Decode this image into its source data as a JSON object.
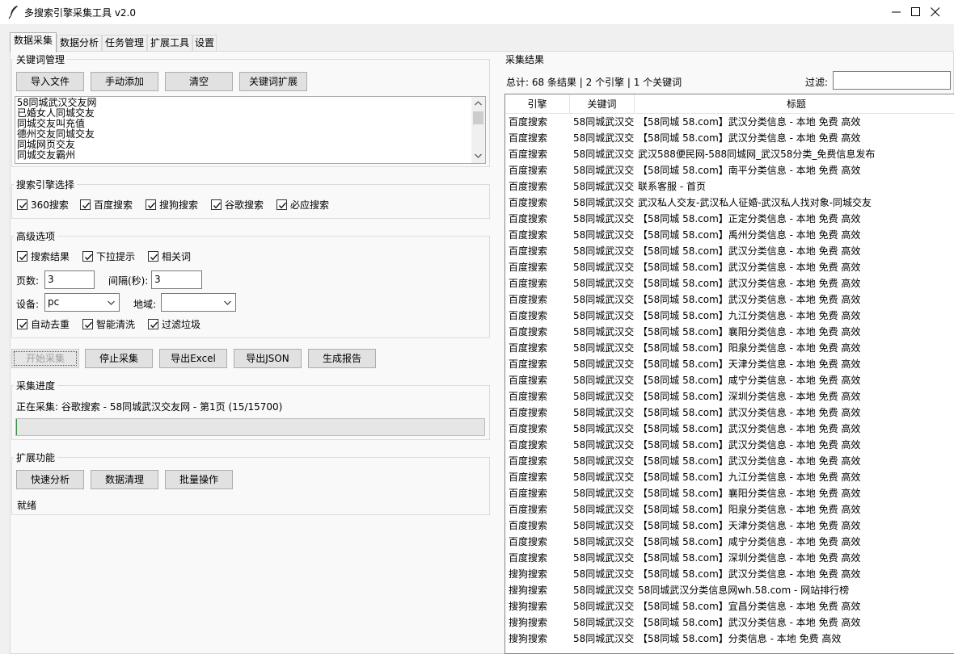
{
  "window": {
    "title": "多搜索引擎采集工具 v2.0"
  },
  "tabs": [
    "数据采集",
    "数据分析",
    "任务管理",
    "扩展工具",
    "设置"
  ],
  "keywords": {
    "group_label": "关键词管理",
    "buttons": [
      "导入文件",
      "手动添加",
      "清空",
      "关键词扩展"
    ],
    "lines": [
      "58同城武汉交友网",
      "已婚女人同城交友",
      "同城交友叫充值",
      "德州交友同城交友",
      "同城网页交友",
      "同城交友霸州"
    ]
  },
  "engines": {
    "group_label": "搜索引擎选择",
    "items": [
      {
        "label": "360搜索",
        "checked": true
      },
      {
        "label": "百度搜索",
        "checked": true
      },
      {
        "label": "搜狗搜索",
        "checked": true
      },
      {
        "label": "谷歌搜索",
        "checked": true
      },
      {
        "label": "必应搜索",
        "checked": true
      }
    ]
  },
  "advanced": {
    "group_label": "高级选项",
    "types": [
      {
        "label": "搜索结果",
        "checked": true
      },
      {
        "label": "下拉提示",
        "checked": true
      },
      {
        "label": "相关词",
        "checked": true
      }
    ],
    "pages_label": "页数:",
    "pages_value": "3",
    "interval_label": "间隔(秒):",
    "interval_value": "3",
    "device_label": "设备:",
    "device_value": "pc",
    "region_label": "地域:",
    "region_value": "",
    "options": [
      {
        "label": "自动去重",
        "checked": true
      },
      {
        "label": "智能清洗",
        "checked": true
      },
      {
        "label": "过滤垃圾",
        "checked": true
      }
    ]
  },
  "actions": [
    "开始采集",
    "停止采集",
    "导出Excel",
    "导出JSON",
    "生成报告"
  ],
  "progress": {
    "group_label": "采集进度",
    "status": "正在采集: 谷歌搜索 - 58同城武汉交友网 - 第1页 (15/15700)",
    "fraction": 0.001
  },
  "extensions": {
    "group_label": "扩展功能",
    "buttons": [
      "快速分析",
      "数据清理",
      "批量操作"
    ],
    "status": "就绪"
  },
  "results": {
    "group_label": "采集结果",
    "summary": "总计: 68 条结果 | 2 个引擎 | 1 个关键词",
    "filter_label": "过滤:",
    "filter_value": "",
    "columns": [
      "引擎",
      "关键词",
      "标题"
    ],
    "rows": [
      [
        "百度搜索",
        "58同城武汉交",
        "【58同城 58.com】武汉分类信息 - 本地 免费 高效"
      ],
      [
        "百度搜索",
        "58同城武汉交",
        "【58同城 58.com】武汉分类信息 - 本地 免费 高效"
      ],
      [
        "百度搜索",
        "58同城武汉交",
        "武汉588便民网-588同城网_武汉58分类_免费信息发布"
      ],
      [
        "百度搜索",
        "58同城武汉交",
        "【58同城 58.com】南平分类信息 - 本地 免费 高效"
      ],
      [
        "百度搜索",
        "58同城武汉交",
        "联系客服 - 首页"
      ],
      [
        "百度搜索",
        "58同城武汉交",
        "武汉私人交友-武汉私人征婚-武汉私人找对象-同城交友"
      ],
      [
        "百度搜索",
        "58同城武汉交",
        "【58同城 58.com】正定分类信息 - 本地 免费 高效"
      ],
      [
        "百度搜索",
        "58同城武汉交",
        "【58同城 58.com】禹州分类信息 - 本地 免费 高效"
      ],
      [
        "百度搜索",
        "58同城武汉交",
        "【58同城 58.com】武汉分类信息 - 本地 免费 高效"
      ],
      [
        "百度搜索",
        "58同城武汉交",
        "【58同城 58.com】武汉分类信息 - 本地 免费 高效"
      ],
      [
        "百度搜索",
        "58同城武汉交",
        "【58同城 58.com】武汉分类信息 - 本地 免费 高效"
      ],
      [
        "百度搜索",
        "58同城武汉交",
        "【58同城 58.com】武汉分类信息 - 本地 免费 高效"
      ],
      [
        "百度搜索",
        "58同城武汉交",
        "【58同城 58.com】九江分类信息 - 本地 免费 高效"
      ],
      [
        "百度搜索",
        "58同城武汉交",
        "【58同城 58.com】襄阳分类信息 - 本地 免费 高效"
      ],
      [
        "百度搜索",
        "58同城武汉交",
        "【58同城 58.com】阳泉分类信息 - 本地 免费 高效"
      ],
      [
        "百度搜索",
        "58同城武汉交",
        "【58同城 58.com】天津分类信息 - 本地 免费 高效"
      ],
      [
        "百度搜索",
        "58同城武汉交",
        "【58同城 58.com】咸宁分类信息 - 本地 免费 高效"
      ],
      [
        "百度搜索",
        "58同城武汉交",
        "【58同城 58.com】深圳分类信息 - 本地 免费 高效"
      ],
      [
        "百度搜索",
        "58同城武汉交",
        "【58同城 58.com】武汉分类信息 - 本地 免费 高效"
      ],
      [
        "百度搜索",
        "58同城武汉交",
        "【58同城 58.com】武汉分类信息 - 本地 免费 高效"
      ],
      [
        "百度搜索",
        "58同城武汉交",
        "【58同城 58.com】武汉分类信息 - 本地 免费 高效"
      ],
      [
        "百度搜索",
        "58同城武汉交",
        "【58同城 58.com】武汉分类信息 - 本地 免费 高效"
      ],
      [
        "百度搜索",
        "58同城武汉交",
        "【58同城 58.com】九江分类信息 - 本地 免费 高效"
      ],
      [
        "百度搜索",
        "58同城武汉交",
        "【58同城 58.com】襄阳分类信息 - 本地 免费 高效"
      ],
      [
        "百度搜索",
        "58同城武汉交",
        "【58同城 58.com】阳泉分类信息 - 本地 免费 高效"
      ],
      [
        "百度搜索",
        "58同城武汉交",
        "【58同城 58.com】天津分类信息 - 本地 免费 高效"
      ],
      [
        "百度搜索",
        "58同城武汉交",
        "【58同城 58.com】咸宁分类信息 - 本地 免费 高效"
      ],
      [
        "百度搜索",
        "58同城武汉交",
        "【58同城 58.com】深圳分类信息 - 本地 免费 高效"
      ],
      [
        "搜狗搜索",
        "58同城武汉交",
        "【58同城 58.com】武汉分类信息 - 本地 免费 高效"
      ],
      [
        "搜狗搜索",
        "58同城武汉交",
        "58同城武汉分类信息网wh.58.com - 网站排行榜"
      ],
      [
        "搜狗搜索",
        "58同城武汉交",
        "【58同城 58.com】宜昌分类信息 - 本地 免费 高效"
      ],
      [
        "搜狗搜索",
        "58同城武汉交",
        "【58同城 58.com】武汉分类信息 - 本地 免费 高效"
      ],
      [
        "搜狗搜索",
        "58同城武汉交",
        "【58同城 58.com】分类信息 - 本地 免费 高效"
      ]
    ]
  }
}
